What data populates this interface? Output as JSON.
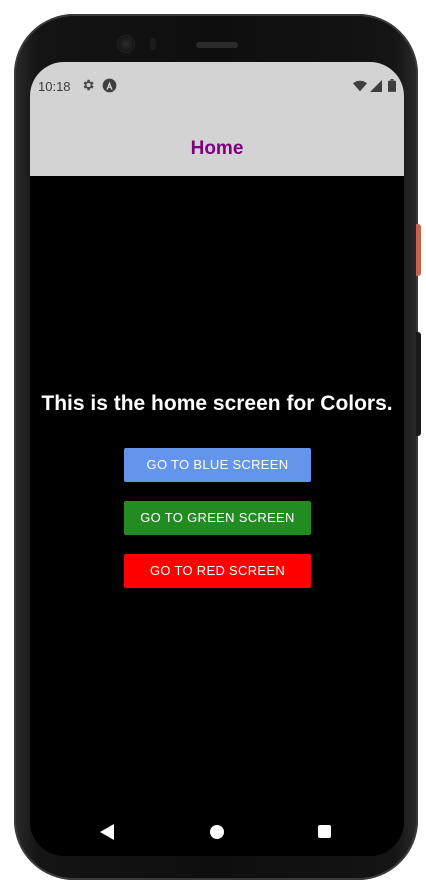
{
  "status_bar": {
    "time": "10:18",
    "icons": [
      "gear-icon",
      "react-a-icon",
      "wifi-icon",
      "signal-icon",
      "battery-icon"
    ]
  },
  "header": {
    "title": "Home",
    "title_color": "#800080",
    "background": "#d3d3d3"
  },
  "main": {
    "message": "This is the home screen for Colors.",
    "background": "#000000",
    "buttons": [
      {
        "label": "GO TO BLUE SCREEN",
        "color": "#6495ed"
      },
      {
        "label": "GO TO GREEN SCREEN",
        "color": "#228b22"
      },
      {
        "label": "GO TO RED SCREEN",
        "color": "#ff0000"
      }
    ]
  },
  "nav_bar": {
    "icons": [
      "back-icon",
      "home-icon",
      "recents-icon"
    ]
  }
}
